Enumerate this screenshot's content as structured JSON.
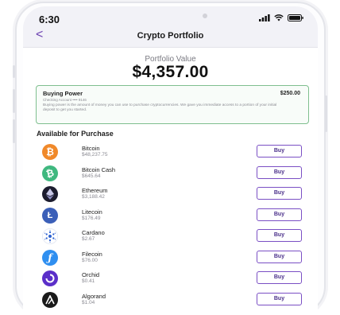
{
  "status_bar": {
    "time": "6:30"
  },
  "nav": {
    "back_label": "<",
    "title": "Crypto Portfolio"
  },
  "portfolio": {
    "label": "Portfolio Value",
    "value": "$4,357.00"
  },
  "buying_power": {
    "title": "Buying Power",
    "amount": "$250.00",
    "account": "Checking Account •••• 9146",
    "description": "Buying power is the amount of money you can use to purchase cryptocurrencies. We gave you immediate access to a portion of your initial deposit to get you started."
  },
  "section_title": "Available for Purchase",
  "buy_label": "Buy",
  "coins": [
    {
      "name": "Bitcoin",
      "price": "$48,237.75",
      "icon": "bitcoin-icon",
      "color": "#f0892a"
    },
    {
      "name": "Bitcoin Cash",
      "price": "$645.64",
      "icon": "bitcoin-cash-icon",
      "color": "#3fb87f"
    },
    {
      "name": "Ethereum",
      "price": "$3,188.42",
      "icon": "ethereum-icon",
      "color": "#1c1c2e"
    },
    {
      "name": "Litecoin",
      "price": "$176.49",
      "icon": "litecoin-icon",
      "color": "#3b5fb8"
    },
    {
      "name": "Cardano",
      "price": "$2.67",
      "icon": "cardano-icon",
      "color": "#2a5fd0"
    },
    {
      "name": "Filecoin",
      "price": "$76.00",
      "icon": "filecoin-icon",
      "color": "#2f8ff0"
    },
    {
      "name": "Orchid",
      "price": "$0.41",
      "icon": "orchid-icon",
      "color": "#5b2fc9"
    },
    {
      "name": "Algorand",
      "price": "$1.04",
      "icon": "algorand-icon",
      "color": "#1a1a1a"
    }
  ]
}
